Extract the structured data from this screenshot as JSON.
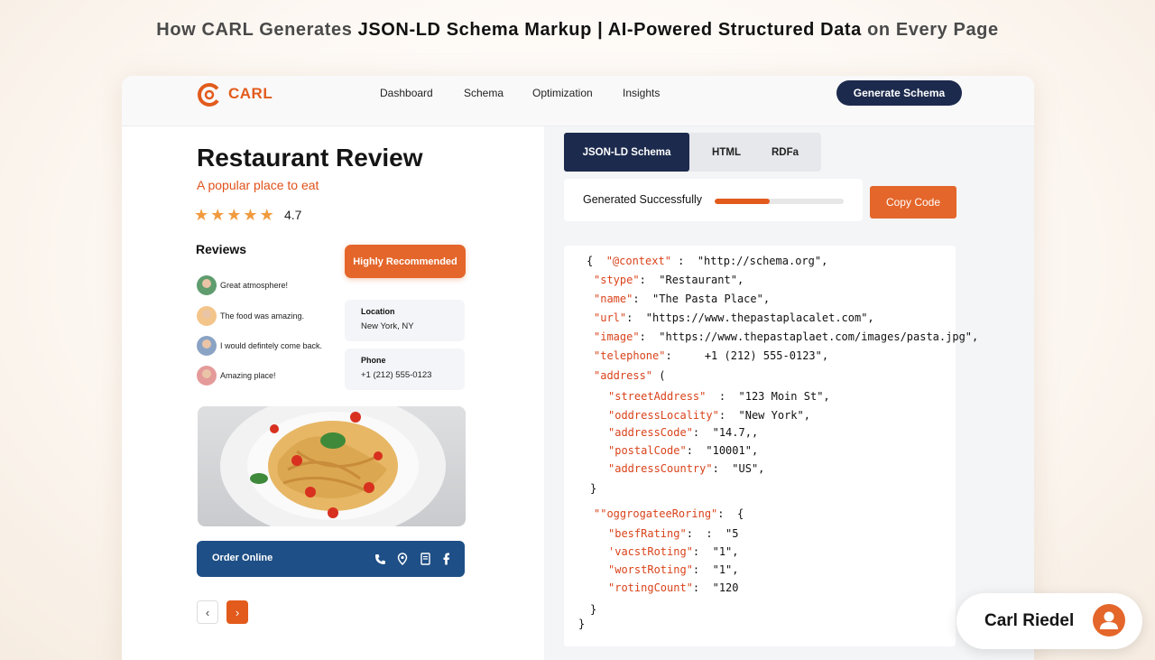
{
  "page": {
    "title_a": "How CARL Generates ",
    "title_b": "JSON-LD Schema Markup | AI-Powered Structured Data",
    "title_c": " on Every Page"
  },
  "nav": {
    "logo_text": "CARL",
    "items": [
      "Dashboard",
      "Schema",
      "Optimization",
      "Insights"
    ],
    "cta": "Generate Schema"
  },
  "restaurant": {
    "title": "Restaurant Review",
    "subtitle": "A popular place to eat",
    "stars": 4.7,
    "rating": "4.7",
    "reviews_heading": "Reviews",
    "badge": "Highly Recommended",
    "reviews": [
      "Great atmosphere!",
      "The food was amazing.",
      "I would defintely come back.",
      "Amazing place!"
    ],
    "location_label": "Location",
    "location_value": "New York, NY",
    "phone_label": "Phone",
    "phone_value": "+1 (212) 555-0123",
    "order_label": "Order Online",
    "order_icons": [
      "phone-icon",
      "map-pin-icon",
      "menu-icon",
      "facebook-icon"
    ]
  },
  "schema_panel": {
    "tabs": [
      "JSON-LD Schema",
      "HTML",
      "RDFa"
    ],
    "active_tab": 0,
    "status": "Generated Successfully",
    "progress": 0.43,
    "copy_label": "Copy Code",
    "code": [
      {
        "key": "{  \"@context\"",
        "val": " :  \"http://schema.org\","
      },
      {
        "key": "\"stype\"",
        "val": ":  \"Restaurant\","
      },
      {
        "key": "\"name\"",
        "val": ":  \"The Pasta Place\","
      },
      {
        "key": "\"url\"",
        "val": ":  \"https://www.thepastaplacalet.com\","
      },
      {
        "key": "\"image\"",
        "val": ":  \"https://www.thepastaplaet.com/images/pasta.jpg\","
      },
      {
        "key": "\"telephone\"",
        "val": ":     +1 (212) 555-0123\","
      },
      {
        "key": "\"address\"",
        "val": " ("
      },
      {
        "key": "\"streetAddress\"",
        "val": "  :  \"123 Moin St\","
      },
      {
        "key": "\"oddressLocality\"",
        "val": ":  \"New York\","
      },
      {
        "key": "\"addressCode\"",
        "val": ":  \"14.7,,"
      },
      {
        "key": "\"postalCode\"",
        "val": ":  \"10001\","
      },
      {
        "key": "\"addressCountry\"",
        "val": ":  \"US\","
      },
      {
        "key": "",
        "val": "}"
      },
      {
        "key": "\"\"oggrogateeRoring\"",
        "val": ":  {"
      },
      {
        "key": "\"besfRating\"",
        "val": ":  :  \"5"
      },
      {
        "key": "'vacstRoting\"",
        "val": ":  \"1\","
      },
      {
        "key": "\"worstRoting\"",
        "val": ":  \"1\","
      },
      {
        "key": "\"rotingCount\"",
        "val": ":  \"120"
      },
      {
        "key": "",
        "val": "}"
      },
      {
        "key": "",
        "val": "}"
      }
    ]
  },
  "user": {
    "name": "Carl Riedel"
  },
  "colors": {
    "accent": "#e25b1c",
    "navy": "#1c2a4d",
    "order_bar": "#1e4f86"
  }
}
